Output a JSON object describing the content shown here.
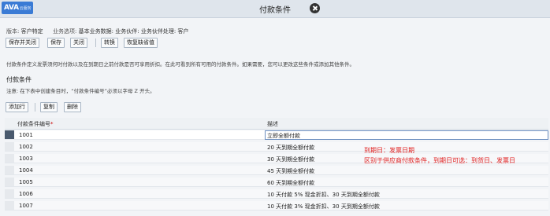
{
  "header": {
    "logo_main": "AVA",
    "logo_sub": "云服务",
    "title": "付款条件"
  },
  "meta": {
    "version_label": "版本:",
    "version_value": "客户特定",
    "business_label": "业务选项:",
    "business_value": "基本业务数据: 业务伙伴: 业务伙伴处理: 客户"
  },
  "toolbar": {
    "save_close": "保存并关闭",
    "save": "保存",
    "close": "关闭",
    "transfer": "转换",
    "restore_defaults": "恢复缺省值"
  },
  "description": "付款条件定义发票须何时付款以及在到期日之前付款是否可享用折扣。在此可看到所有可用的付款条件。如果需要，您可以更改这些条件或添加其他条件。",
  "section": {
    "title": "付款条件",
    "note": "注意: 在下表中创建条目时，“付款条件编号”必须以字母 Z 开头。"
  },
  "table_toolbar": {
    "add_row": "添加行",
    "copy": "复制",
    "delete": "删除"
  },
  "table": {
    "columns": [
      "付款条件编号",
      "描述"
    ],
    "required_mark": "*",
    "rows": [
      {
        "code": "1001",
        "description": "立即全额付款"
      },
      {
        "code": "1002",
        "description": "20 天到期全额付款"
      },
      {
        "code": "1003",
        "description": "30 天到期全额付款"
      },
      {
        "code": "1004",
        "description": "45 天到期全额付款"
      },
      {
        "code": "1005",
        "description": "60 天到期全额付款"
      },
      {
        "code": "1006",
        "description": "10 天付款 5% 现金折扣、30 天到期全额付款"
      },
      {
        "code": "1007",
        "description": "10 天付款 3% 现金折扣、30 天到期全额付款"
      }
    ]
  },
  "annotations": {
    "line1": "到期日：发票日期",
    "line2": "区别于供应商付款条件，到期日可选：到货日、发票日",
    "color": "#e02020"
  }
}
